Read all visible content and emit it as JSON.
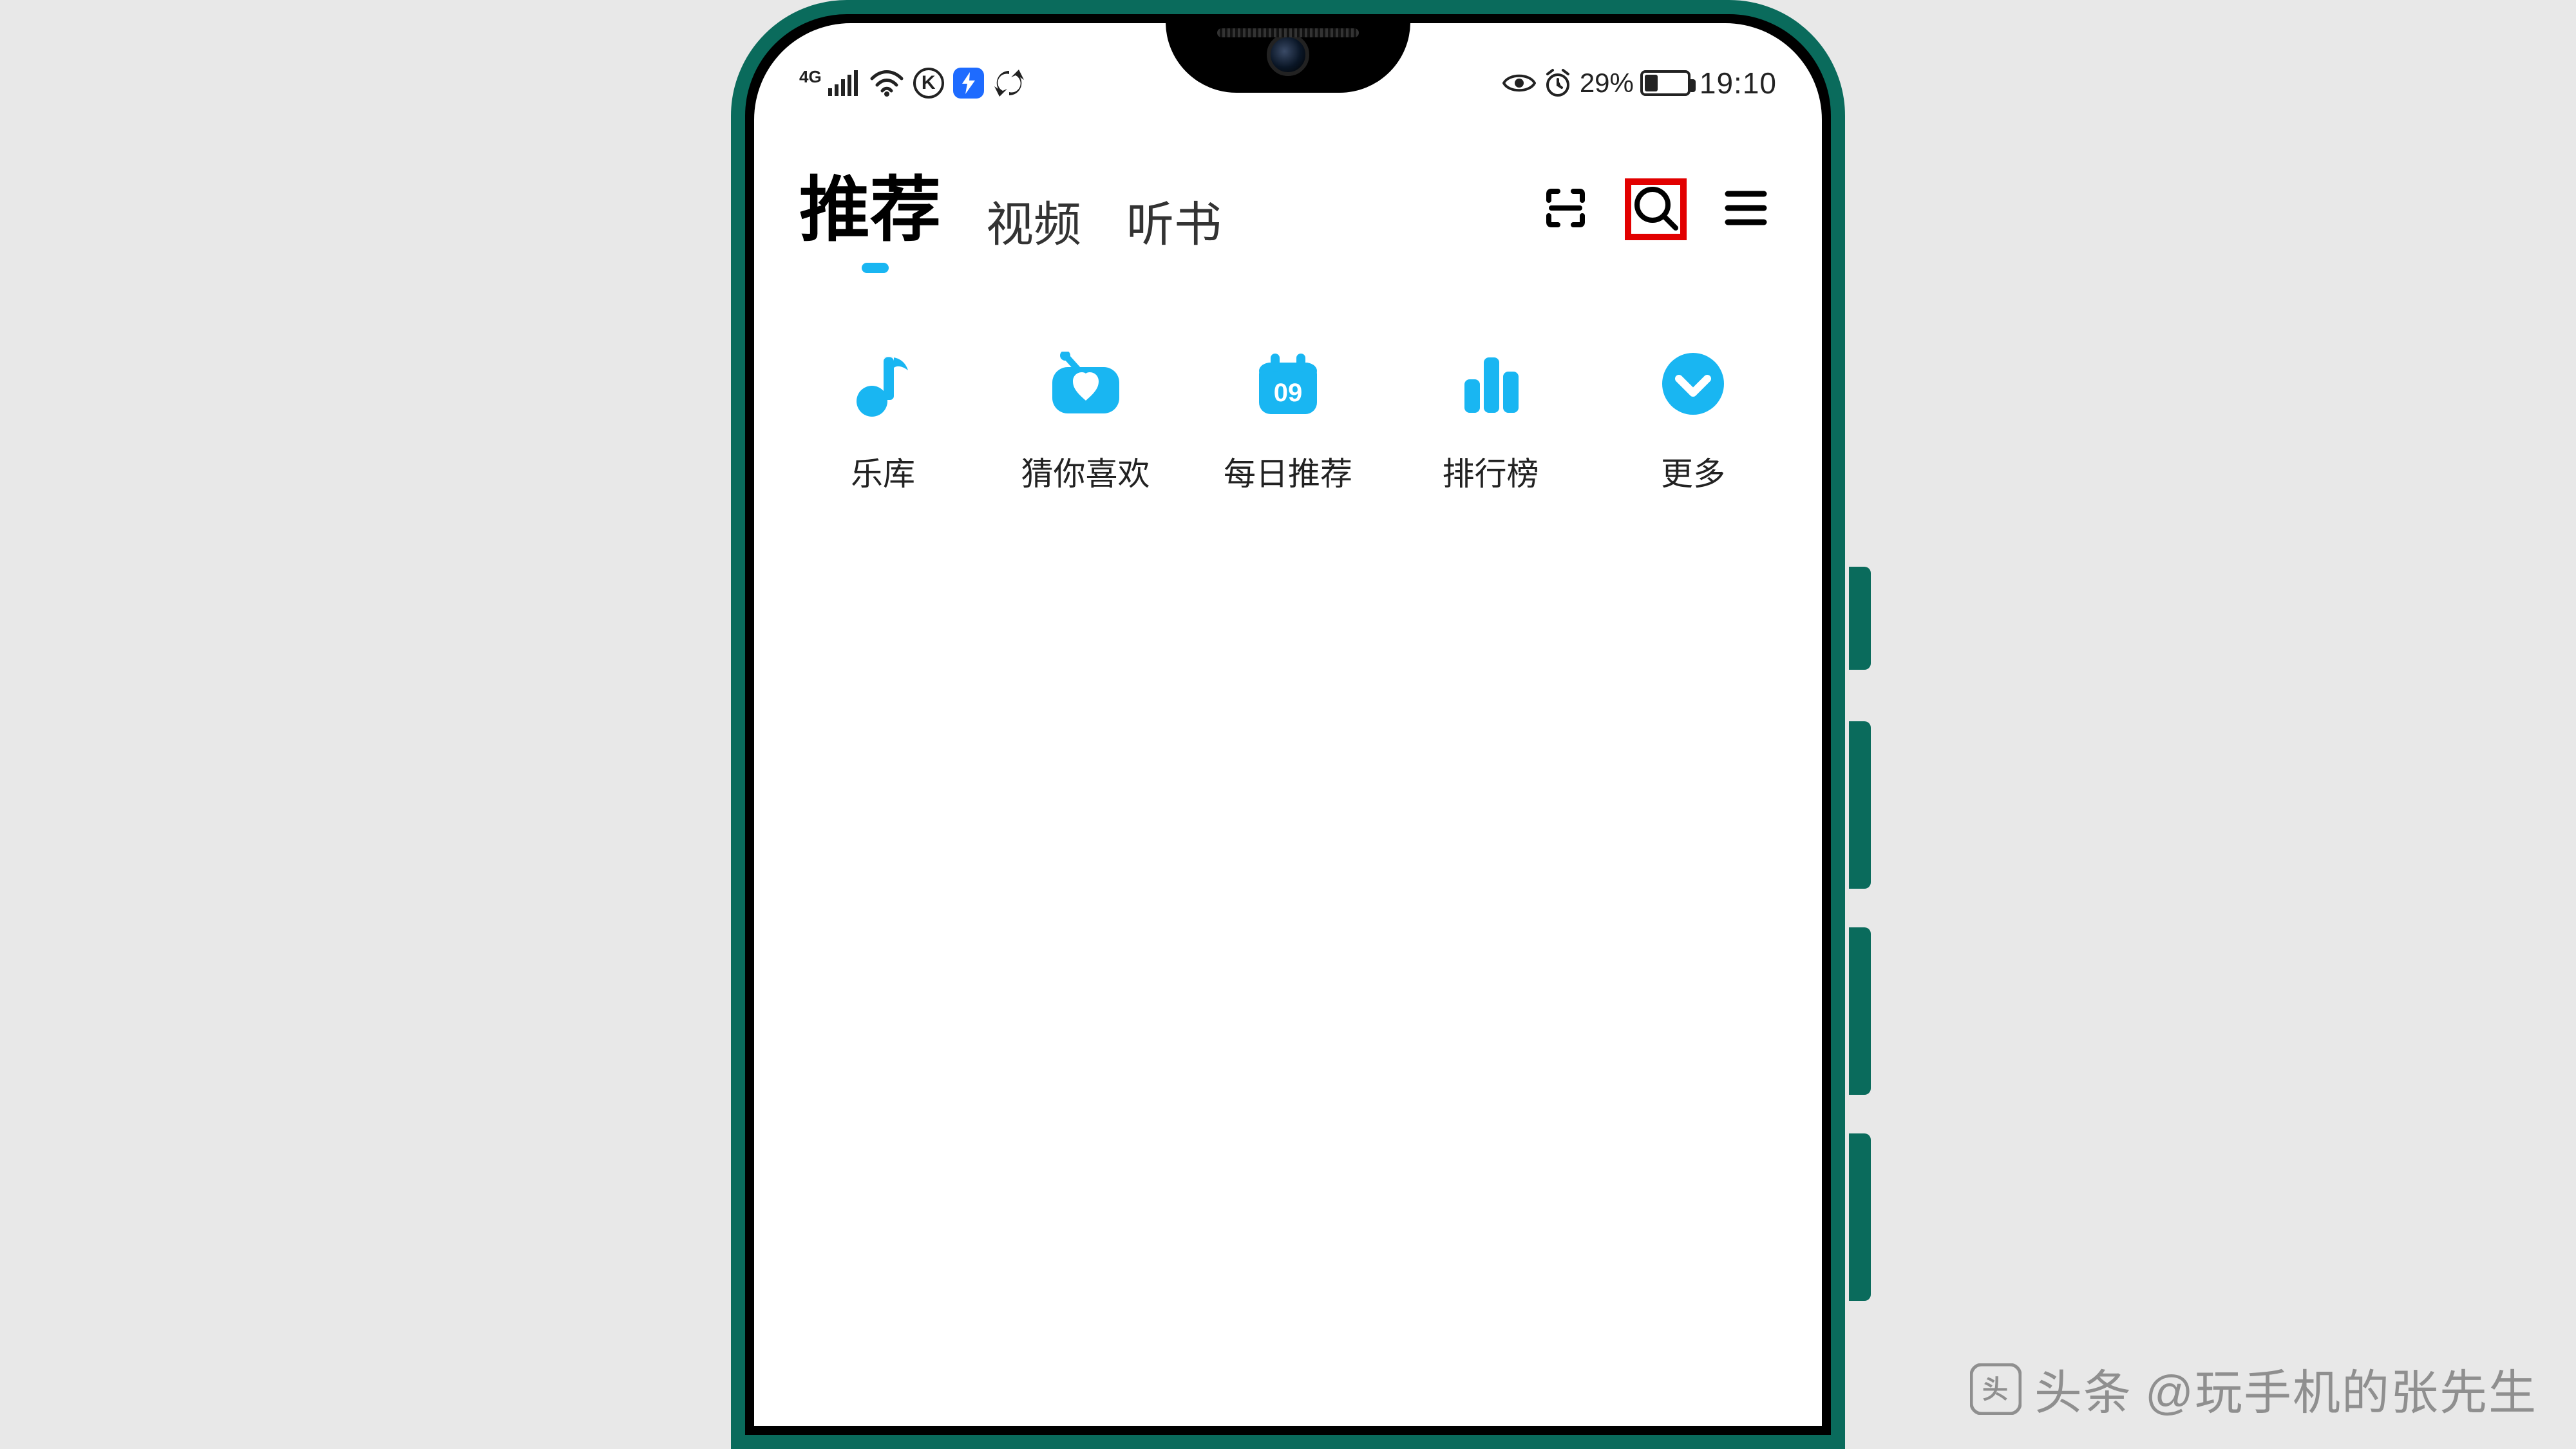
{
  "status_bar": {
    "network_label": "4G",
    "k_badge": "K",
    "battery_percent_text": "29%",
    "battery_fill_percent": 29,
    "time": "19:10"
  },
  "tabs": {
    "items": [
      {
        "label": "推荐",
        "active": true
      },
      {
        "label": "视频",
        "active": false
      },
      {
        "label": "听书",
        "active": false
      }
    ]
  },
  "top_actions": {
    "scan": "scan-icon",
    "search": "search-icon",
    "menu": "menu-icon",
    "search_highlighted": true
  },
  "categories": {
    "items": [
      {
        "label": "乐库",
        "icon": "music-note-icon"
      },
      {
        "label": "猜你喜欢",
        "icon": "radio-heart-icon"
      },
      {
        "label": "每日推荐",
        "icon": "calendar-icon",
        "day": "09"
      },
      {
        "label": "排行榜",
        "icon": "bar-chart-icon"
      },
      {
        "label": "更多",
        "icon": "more-circle-icon"
      }
    ]
  },
  "colors": {
    "accent": "#19b6f2",
    "frame": "#0a6b5c",
    "highlight": "#e20000"
  },
  "watermark": {
    "prefix": "头条",
    "handle": "@玩手机的张先生"
  }
}
